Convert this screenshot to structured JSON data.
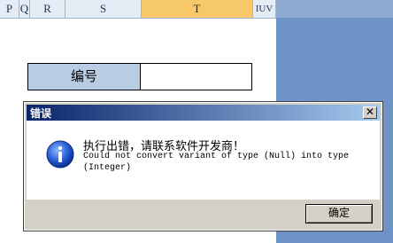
{
  "spreadsheet": {
    "columns": [
      "P",
      "Q",
      "R",
      "S",
      "T",
      "IUV"
    ],
    "selected_column": "T",
    "cells": {
      "label": "编号",
      "value": ""
    }
  },
  "dialog": {
    "title": "错误",
    "close_symbol": "✕",
    "message": "执行出错，请联系软件开发商！",
    "detail": "Could not convert variant of type (Null) into type (Integer)",
    "ok_label": "确定",
    "icon": "info-icon"
  },
  "colors": {
    "titlebar": "#0a246a",
    "selected_header": "#f7c86a",
    "label_cell": "#b8cce4",
    "workspace": "#6e93c6"
  }
}
